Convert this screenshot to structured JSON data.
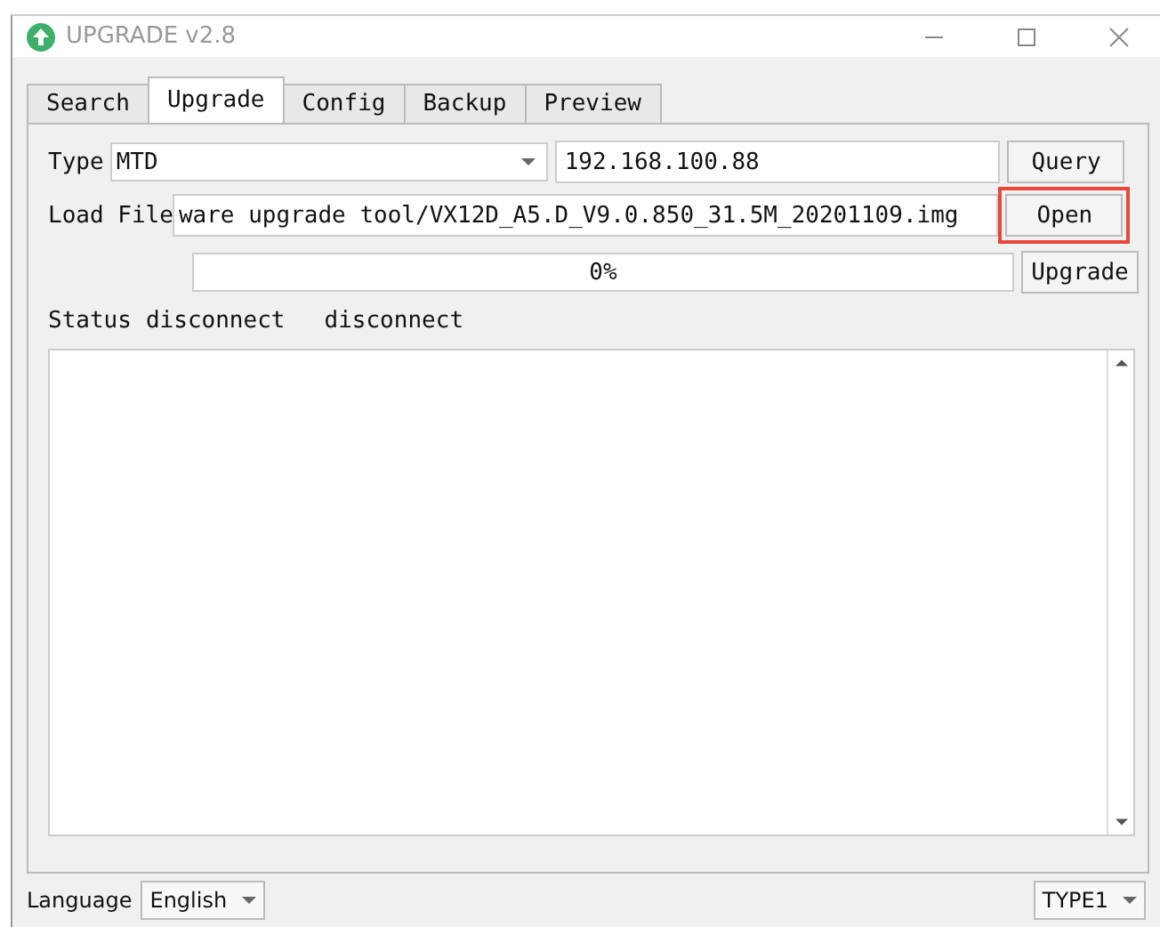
{
  "window": {
    "title": "UPGRADE v2.8"
  },
  "tabs": [
    {
      "label": "Search",
      "selected": false
    },
    {
      "label": "Upgrade",
      "selected": true
    },
    {
      "label": "Config",
      "selected": false
    },
    {
      "label": "Backup",
      "selected": false
    },
    {
      "label": "Preview",
      "selected": false
    }
  ],
  "type_row": {
    "label": "Type",
    "type_value": "MTD",
    "ip": "192.168.100.88",
    "button": "Query"
  },
  "file_row": {
    "label": "Load File",
    "path": "ware upgrade tool/VX12D_A5.D_V9.0.850_31.5M_20201109.img",
    "button": "Open",
    "highlighted": true
  },
  "progress": {
    "reading": "0%",
    "button": "Upgrade"
  },
  "status": {
    "label": "Status",
    "value1": "disconnect",
    "value2": "disconnect"
  },
  "footer": {
    "language_label": "Language",
    "language": "English",
    "type": "TYPE1"
  }
}
